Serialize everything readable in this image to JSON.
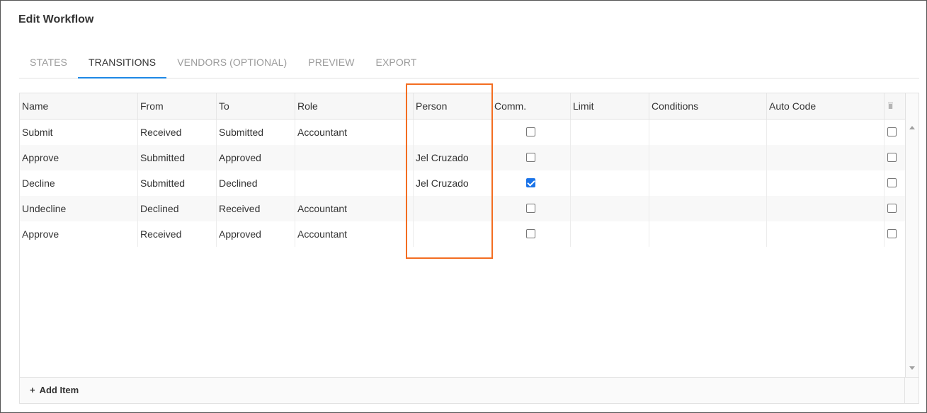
{
  "window": {
    "title": "Edit Workflow"
  },
  "tabs": [
    {
      "label": "STATES",
      "active": false
    },
    {
      "label": "TRANSITIONS",
      "active": true
    },
    {
      "label": "VENDORS (OPTIONAL)",
      "active": false
    },
    {
      "label": "PREVIEW",
      "active": false
    },
    {
      "label": "EXPORT",
      "active": false
    }
  ],
  "table": {
    "columns": [
      "Name",
      "From",
      "To",
      "Role",
      "Person",
      "Comm.",
      "Limit",
      "Conditions",
      "Auto Code"
    ],
    "delete_column_icon": "trash-icon",
    "rows": [
      {
        "name": "Submit",
        "from": "Received",
        "to": "Submitted",
        "role": "Accountant",
        "person": "",
        "comm": false,
        "limit": "",
        "conditions": "",
        "auto_code": "",
        "selected": false
      },
      {
        "name": "Approve",
        "from": "Submitted",
        "to": "Approved",
        "role": "",
        "person": "Jel Cruzado",
        "comm": false,
        "limit": "",
        "conditions": "",
        "auto_code": "",
        "selected": false
      },
      {
        "name": "Decline",
        "from": "Submitted",
        "to": "Declined",
        "role": "",
        "person": "Jel Cruzado",
        "comm": true,
        "limit": "",
        "conditions": "",
        "auto_code": "",
        "selected": false
      },
      {
        "name": "Undecline",
        "from": "Declined",
        "to": "Received",
        "role": "Accountant",
        "person": "",
        "comm": false,
        "limit": "",
        "conditions": "",
        "auto_code": "",
        "selected": false
      },
      {
        "name": "Approve",
        "from": "Received",
        "to": "Approved",
        "role": "Accountant",
        "person": "",
        "comm": false,
        "limit": "",
        "conditions": "",
        "auto_code": "",
        "selected": false
      }
    ]
  },
  "footer": {
    "add_item_icon": "+",
    "add_item_label": "Add Item"
  },
  "colors": {
    "accent": "#1e88e5",
    "checkbox_checked": "#1a73e8",
    "highlight_annotation": "#f36d21"
  }
}
